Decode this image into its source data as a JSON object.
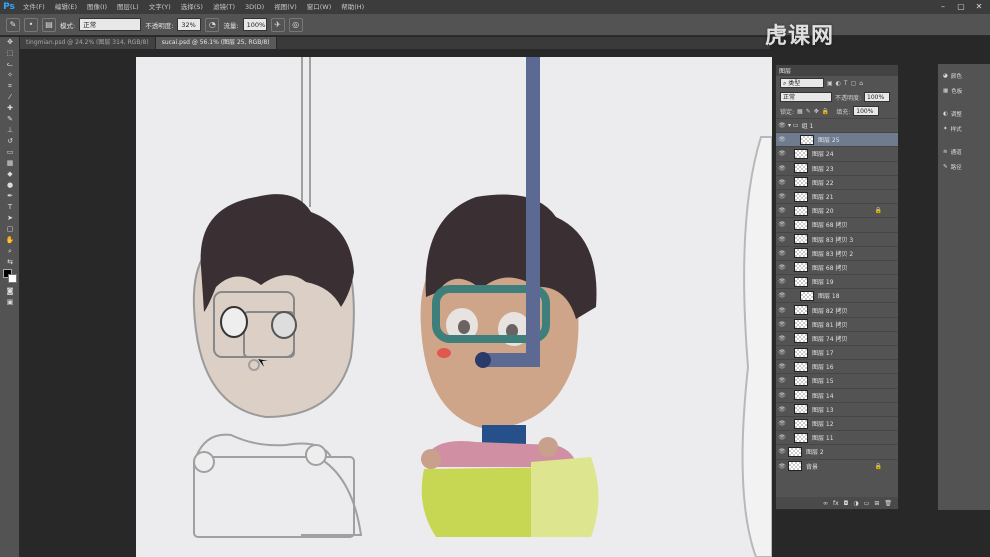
{
  "app": {
    "logo": "Ps"
  },
  "menu": [
    "文件(F)",
    "编辑(E)",
    "图像(I)",
    "图层(L)",
    "文字(Y)",
    "选择(S)",
    "滤镜(T)",
    "3D(D)",
    "视图(V)",
    "窗口(W)",
    "帮助(H)"
  ],
  "options": {
    "mode_label": "模式:",
    "mode_value": "正常",
    "opacity_label": "不透明度:",
    "opacity_value": "32%",
    "flow_label": "流量:",
    "flow_value": "100%"
  },
  "tabs": [
    {
      "label": "tingmian.psd @ 24.2% (图层 314, RGB/8)",
      "active": false
    },
    {
      "label": "sucai.psd @ 56.1% (图层 25, RGB/8)",
      "active": true
    }
  ],
  "layers_panel": {
    "tab": "图层",
    "blend_mode": "正常",
    "opacity_label": "不透明度:",
    "opacity_value": "100%",
    "lock_label": "锁定:",
    "fill_label": "填充:",
    "fill_value": "100%",
    "layers": [
      {
        "name": "组 1",
        "indent": 0,
        "selected": false
      },
      {
        "name": "图层 25",
        "indent": 2,
        "selected": true
      },
      {
        "name": "图层 24",
        "indent": 1,
        "selected": false
      },
      {
        "name": "图层 23",
        "indent": 1,
        "selected": false
      },
      {
        "name": "图层 22",
        "indent": 1,
        "selected": false
      },
      {
        "name": "图层 21",
        "indent": 1,
        "selected": false
      },
      {
        "name": "图层 20",
        "indent": 1,
        "selected": false,
        "locked": true
      },
      {
        "name": "图层 68 拷贝",
        "indent": 1,
        "selected": false
      },
      {
        "name": "图层 83 拷贝 3",
        "indent": 1,
        "selected": false
      },
      {
        "name": "图层 83 拷贝 2",
        "indent": 1,
        "selected": false
      },
      {
        "name": "图层 68 拷贝",
        "indent": 1,
        "selected": false
      },
      {
        "name": "图层 19",
        "indent": 1,
        "selected": false
      },
      {
        "name": "图层 18",
        "indent": 2,
        "selected": false
      },
      {
        "name": "图层 82 拷贝",
        "indent": 1,
        "selected": false
      },
      {
        "name": "图层 81 拷贝",
        "indent": 1,
        "selected": false
      },
      {
        "name": "图层 74 拷贝",
        "indent": 1,
        "selected": false
      },
      {
        "name": "图层 17",
        "indent": 1,
        "selected": false
      },
      {
        "name": "图层 16",
        "indent": 1,
        "selected": false
      },
      {
        "name": "图层 15",
        "indent": 1,
        "selected": false
      },
      {
        "name": "图层 14",
        "indent": 1,
        "selected": false
      },
      {
        "name": "图层 13",
        "indent": 1,
        "selected": false
      },
      {
        "name": "图层 12",
        "indent": 1,
        "selected": false
      },
      {
        "name": "图层 11",
        "indent": 1,
        "selected": false
      },
      {
        "name": "图层 2",
        "indent": 0,
        "selected": false
      },
      {
        "name": "背景",
        "indent": 0,
        "selected": false,
        "locked": true
      }
    ]
  },
  "side_panel": {
    "items": [
      "颜色",
      "色板",
      "调整",
      "样式",
      "通道",
      "路径"
    ]
  },
  "watermark": "虎课网"
}
